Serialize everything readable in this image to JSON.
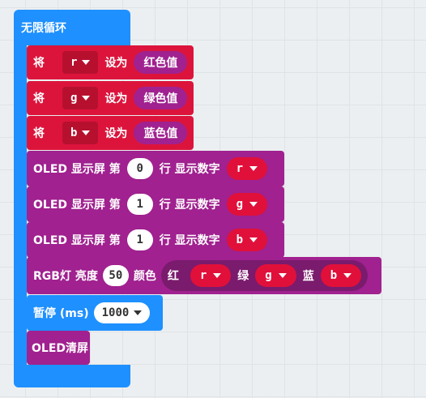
{
  "colors": {
    "loop": "#1e90ff",
    "variables": "#dc143c",
    "oled": "#a0218f",
    "pill_dark": "#7a1b6d",
    "value_red": "#e0103a",
    "input_white": "#ffffff",
    "dd_dark": "#b7102f"
  },
  "loop": {
    "label": "无限循环"
  },
  "set_blocks": [
    {
      "prefix": "将",
      "var": "r",
      "middle": "设为",
      "value": "红色值"
    },
    {
      "prefix": "将",
      "var": "g",
      "middle": "设为",
      "value": "绿色值"
    },
    {
      "prefix": "将",
      "var": "b",
      "middle": "设为",
      "value": "蓝色值"
    }
  ],
  "oled_blocks": [
    {
      "label1": "OLED 显示屏 第",
      "line": "0",
      "label2": "行 显示数字",
      "var": "r"
    },
    {
      "label1": "OLED 显示屏 第",
      "line": "1",
      "label2": "行 显示数字",
      "var": "g"
    },
    {
      "label1": "OLED 显示屏 第",
      "line": "1",
      "label2": "行 显示数字",
      "var": "b"
    }
  ],
  "rgb_block": {
    "label": "RGB灯 亮度",
    "brightness": "50",
    "color_label": "颜色",
    "red_label": "红",
    "red_var": "r",
    "green_label": "绿",
    "green_var": "g",
    "blue_label": "蓝",
    "blue_var": "b"
  },
  "pause_block": {
    "label": "暂停 (ms)",
    "value": "1000"
  },
  "clear_block": {
    "label": "OLED清屏"
  }
}
